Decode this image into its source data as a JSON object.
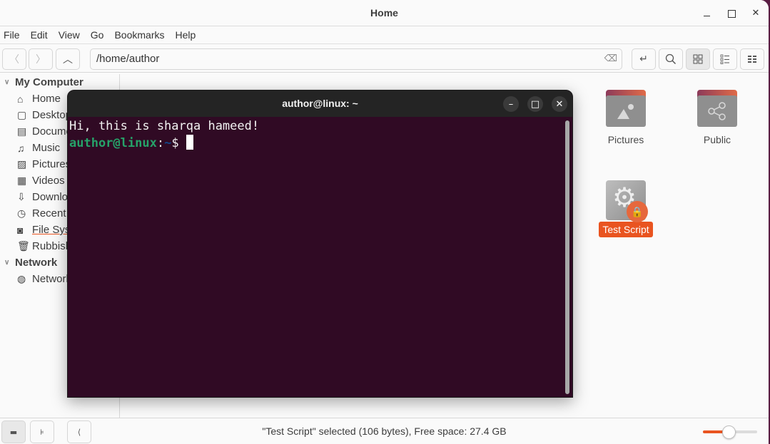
{
  "file_manager": {
    "title": "Home",
    "menu": [
      "File",
      "Edit",
      "View",
      "Go",
      "Bookmarks",
      "Help"
    ],
    "path": "/home/author",
    "sidebar": {
      "sections": [
        {
          "label": "My Computer",
          "items": [
            {
              "label": "Home",
              "icon": "home-icon"
            },
            {
              "label": "Desktop",
              "icon": "desktop-icon"
            },
            {
              "label": "Documents",
              "icon": "document-icon"
            },
            {
              "label": "Music",
              "icon": "music-icon"
            },
            {
              "label": "Pictures",
              "icon": "picture-icon"
            },
            {
              "label": "Videos",
              "icon": "video-icon"
            },
            {
              "label": "Downloads",
              "icon": "download-icon"
            },
            {
              "label": "Recent",
              "icon": "recent-icon"
            },
            {
              "label": "File System",
              "icon": "drive-icon"
            },
            {
              "label": "Rubbish Bin",
              "icon": "trash-icon"
            }
          ]
        },
        {
          "label": "Network",
          "items": [
            {
              "label": "Network",
              "icon": "network-icon"
            }
          ]
        }
      ]
    },
    "files": [
      {
        "name": "Pictures",
        "type": "folder",
        "emblem": "picture"
      },
      {
        "name": "Public",
        "type": "folder",
        "emblem": "share"
      },
      {
        "name": "Test Script",
        "type": "script",
        "locked": true,
        "selected": true
      }
    ],
    "status": "\"Test Script\" selected (106 bytes), Free space: 27.4 GB",
    "zoom_level": 0.48,
    "accent": "#e95420"
  },
  "terminal": {
    "title": "author@linux: ~",
    "output_line": "Hi, this is sharqa hameed!",
    "prompt_user": "author@linux",
    "prompt_sep": ":",
    "prompt_path": "~",
    "prompt_symbol": "$ ",
    "background": "#300a24"
  }
}
